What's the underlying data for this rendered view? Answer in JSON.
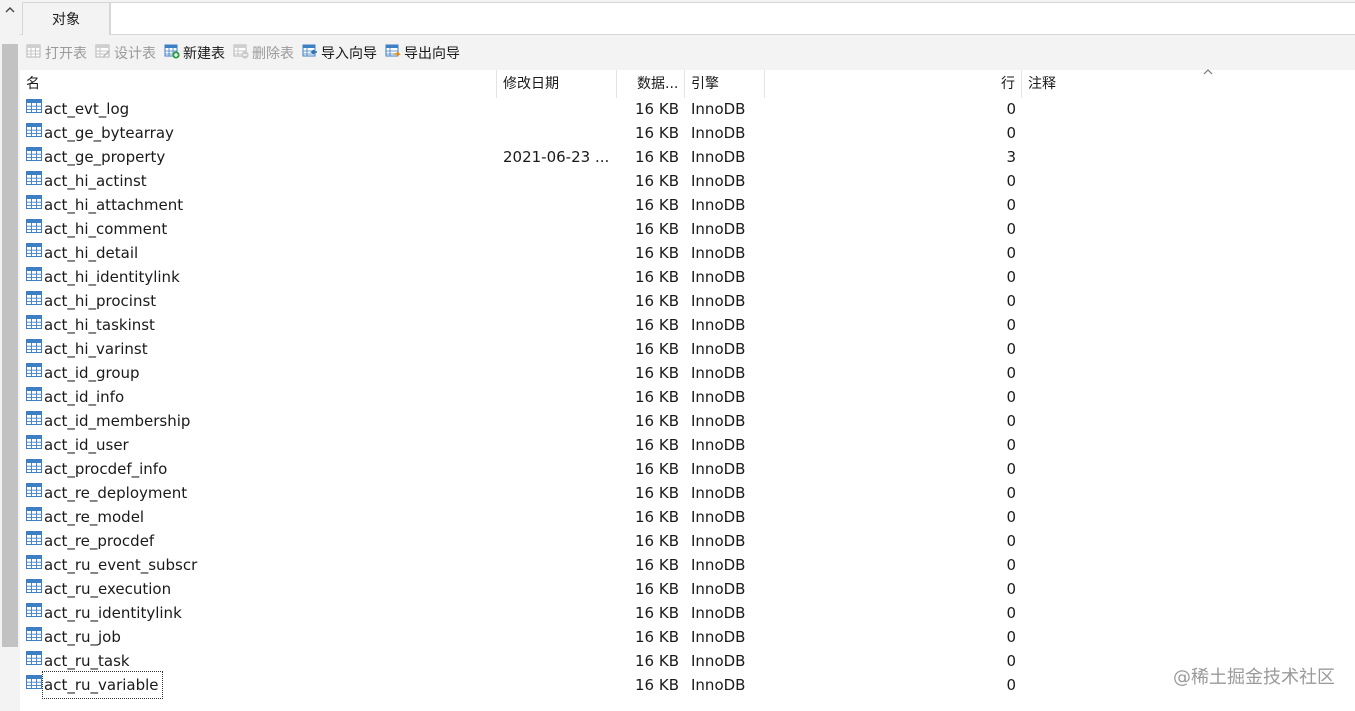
{
  "tab": {
    "label": "对象"
  },
  "toolbar": {
    "items": [
      {
        "label": "打开表",
        "enabled": false,
        "icon": "open-table-icon"
      },
      {
        "label": "设计表",
        "enabled": false,
        "icon": "design-table-icon"
      },
      {
        "label": "新建表",
        "enabled": true,
        "icon": "new-table-icon"
      },
      {
        "label": "删除表",
        "enabled": false,
        "icon": "delete-table-icon"
      },
      {
        "label": "导入向导",
        "enabled": true,
        "icon": "import-wizard-icon"
      },
      {
        "label": "导出向导",
        "enabled": true,
        "icon": "export-wizard-icon"
      }
    ]
  },
  "table": {
    "columns": {
      "name": "名",
      "modified": "修改日期",
      "data_size": "数据...",
      "engine": "引擎",
      "rows": "行",
      "comment": "注释"
    },
    "rows": [
      {
        "name": "act_evt_log",
        "modified": "",
        "size": "16 KB",
        "engine": "InnoDB",
        "rows": "0",
        "comment": ""
      },
      {
        "name": "act_ge_bytearray",
        "modified": "",
        "size": "16 KB",
        "engine": "InnoDB",
        "rows": "0",
        "comment": ""
      },
      {
        "name": "act_ge_property",
        "modified": "2021-06-23 ...",
        "size": "16 KB",
        "engine": "InnoDB",
        "rows": "3",
        "comment": ""
      },
      {
        "name": "act_hi_actinst",
        "modified": "",
        "size": "16 KB",
        "engine": "InnoDB",
        "rows": "0",
        "comment": ""
      },
      {
        "name": "act_hi_attachment",
        "modified": "",
        "size": "16 KB",
        "engine": "InnoDB",
        "rows": "0",
        "comment": ""
      },
      {
        "name": "act_hi_comment",
        "modified": "",
        "size": "16 KB",
        "engine": "InnoDB",
        "rows": "0",
        "comment": ""
      },
      {
        "name": "act_hi_detail",
        "modified": "",
        "size": "16 KB",
        "engine": "InnoDB",
        "rows": "0",
        "comment": ""
      },
      {
        "name": "act_hi_identitylink",
        "modified": "",
        "size": "16 KB",
        "engine": "InnoDB",
        "rows": "0",
        "comment": ""
      },
      {
        "name": "act_hi_procinst",
        "modified": "",
        "size": "16 KB",
        "engine": "InnoDB",
        "rows": "0",
        "comment": ""
      },
      {
        "name": "act_hi_taskinst",
        "modified": "",
        "size": "16 KB",
        "engine": "InnoDB",
        "rows": "0",
        "comment": ""
      },
      {
        "name": "act_hi_varinst",
        "modified": "",
        "size": "16 KB",
        "engine": "InnoDB",
        "rows": "0",
        "comment": ""
      },
      {
        "name": "act_id_group",
        "modified": "",
        "size": "16 KB",
        "engine": "InnoDB",
        "rows": "0",
        "comment": ""
      },
      {
        "name": "act_id_info",
        "modified": "",
        "size": "16 KB",
        "engine": "InnoDB",
        "rows": "0",
        "comment": ""
      },
      {
        "name": "act_id_membership",
        "modified": "",
        "size": "16 KB",
        "engine": "InnoDB",
        "rows": "0",
        "comment": ""
      },
      {
        "name": "act_id_user",
        "modified": "",
        "size": "16 KB",
        "engine": "InnoDB",
        "rows": "0",
        "comment": ""
      },
      {
        "name": "act_procdef_info",
        "modified": "",
        "size": "16 KB",
        "engine": "InnoDB",
        "rows": "0",
        "comment": ""
      },
      {
        "name": "act_re_deployment",
        "modified": "",
        "size": "16 KB",
        "engine": "InnoDB",
        "rows": "0",
        "comment": ""
      },
      {
        "name": "act_re_model",
        "modified": "",
        "size": "16 KB",
        "engine": "InnoDB",
        "rows": "0",
        "comment": ""
      },
      {
        "name": "act_re_procdef",
        "modified": "",
        "size": "16 KB",
        "engine": "InnoDB",
        "rows": "0",
        "comment": ""
      },
      {
        "name": "act_ru_event_subscr",
        "modified": "",
        "size": "16 KB",
        "engine": "InnoDB",
        "rows": "0",
        "comment": ""
      },
      {
        "name": "act_ru_execution",
        "modified": "",
        "size": "16 KB",
        "engine": "InnoDB",
        "rows": "0",
        "comment": ""
      },
      {
        "name": "act_ru_identitylink",
        "modified": "",
        "size": "16 KB",
        "engine": "InnoDB",
        "rows": "0",
        "comment": ""
      },
      {
        "name": "act_ru_job",
        "modified": "",
        "size": "16 KB",
        "engine": "InnoDB",
        "rows": "0",
        "comment": ""
      },
      {
        "name": "act_ru_task",
        "modified": "",
        "size": "16 KB",
        "engine": "InnoDB",
        "rows": "0",
        "comment": ""
      },
      {
        "name": "act_ru_variable",
        "modified": "",
        "size": "16 KB",
        "engine": "InnoDB",
        "rows": "0",
        "comment": "",
        "focused": true
      }
    ]
  },
  "watermark": {
    "text": "@稀土掘金技术社区"
  },
  "colors": {
    "table_icon_blue": "#3d7fc4",
    "add_green": "#2e9e3e",
    "disabled_gray": "#9a9a9a"
  }
}
